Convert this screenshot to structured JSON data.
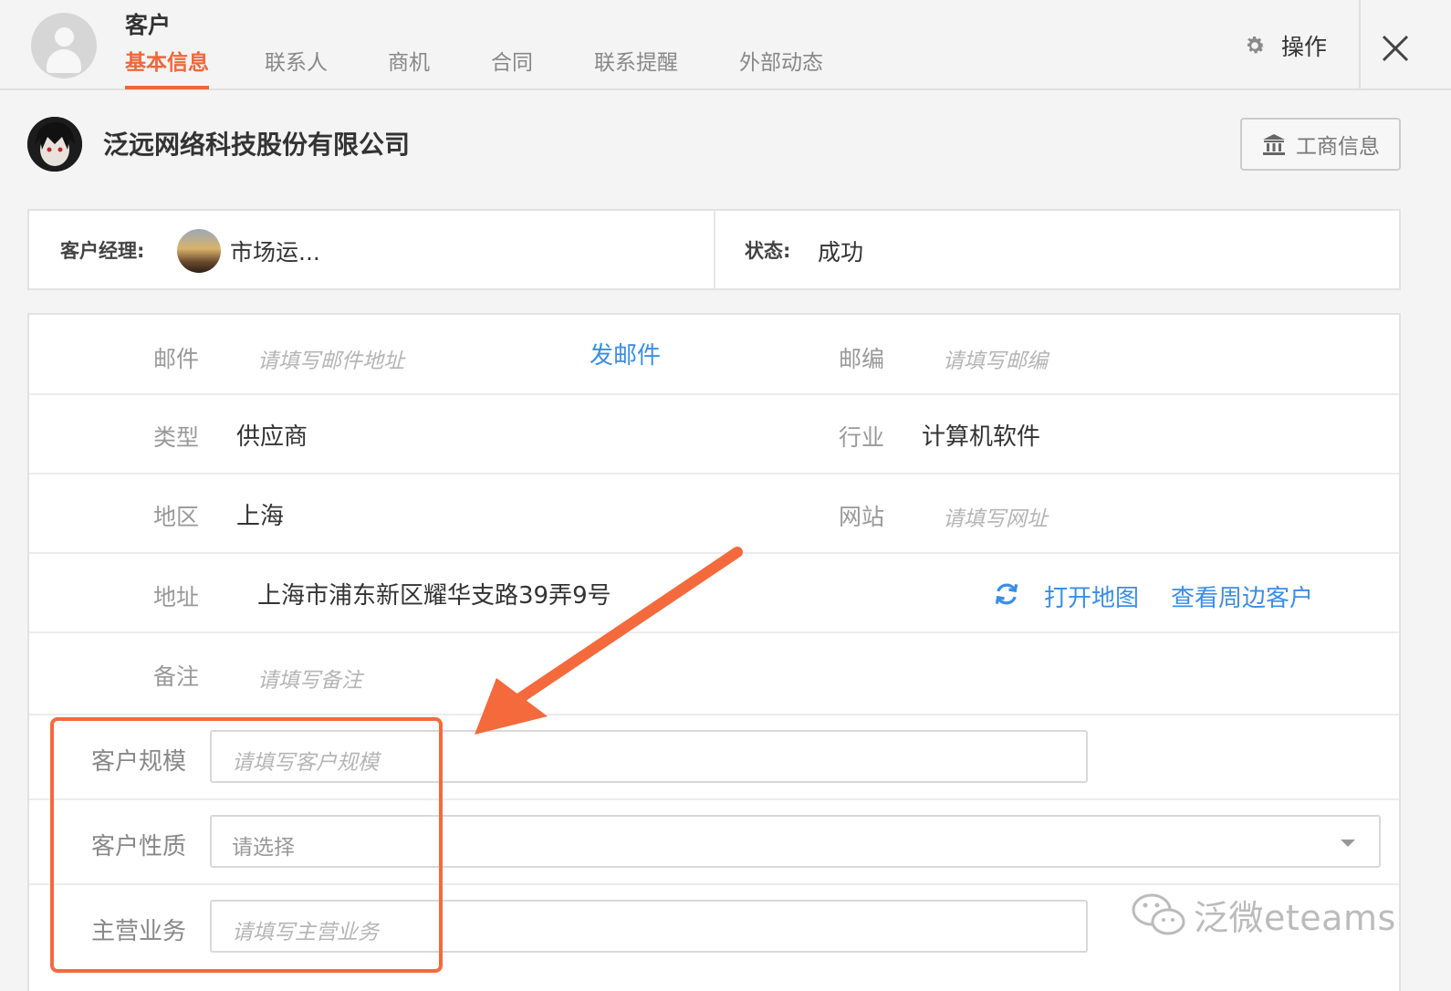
{
  "header": {
    "module_title": "客户",
    "tabs": [
      {
        "label": "基本信息",
        "active": true
      },
      {
        "label": "联系人",
        "active": false
      },
      {
        "label": "商机",
        "active": false
      },
      {
        "label": "合同",
        "active": false
      },
      {
        "label": "联系提醒",
        "active": false
      },
      {
        "label": "外部动态",
        "active": false
      }
    ],
    "operations_label": "操作"
  },
  "company": {
    "name": "泛远网络科技股份有限公司",
    "business_info_button": "工商信息"
  },
  "summary": {
    "manager_label": "客户经理:",
    "manager_name": "市场运...",
    "status_label": "状态:",
    "status_value": "成功"
  },
  "form": {
    "email": {
      "label": "邮件",
      "placeholder": "请填写邮件地址",
      "action": "发邮件"
    },
    "postcode": {
      "label": "邮编",
      "placeholder": "请填写邮编"
    },
    "type": {
      "label": "类型",
      "value": "供应商"
    },
    "industry": {
      "label": "行业",
      "value": "计算机软件"
    },
    "region": {
      "label": "地区",
      "value": "上海"
    },
    "website": {
      "label": "网站",
      "placeholder": "请填写网址"
    },
    "address": {
      "label": "地址",
      "value": "上海市浦东新区耀华支路39弄9号",
      "open_map": "打开地图",
      "nearby": "查看周边客户"
    },
    "remark": {
      "label": "备注",
      "placeholder": "请填写备注"
    },
    "scale": {
      "label": "客户规模",
      "placeholder": "请填写客户规模"
    },
    "nature": {
      "label": "客户性质",
      "selected": "请选择"
    },
    "business": {
      "label": "主营业务",
      "placeholder": "请填写主营业务"
    }
  },
  "watermark": "泛微eteams",
  "colors": {
    "accent": "#f0663a",
    "link": "#3a8ee6",
    "annotation": "#f46a3c"
  },
  "icons": [
    "user-avatar-icon",
    "gear-icon",
    "close-icon",
    "bank-icon",
    "refresh-icon",
    "chevron-down-icon",
    "wechat-icon"
  ]
}
